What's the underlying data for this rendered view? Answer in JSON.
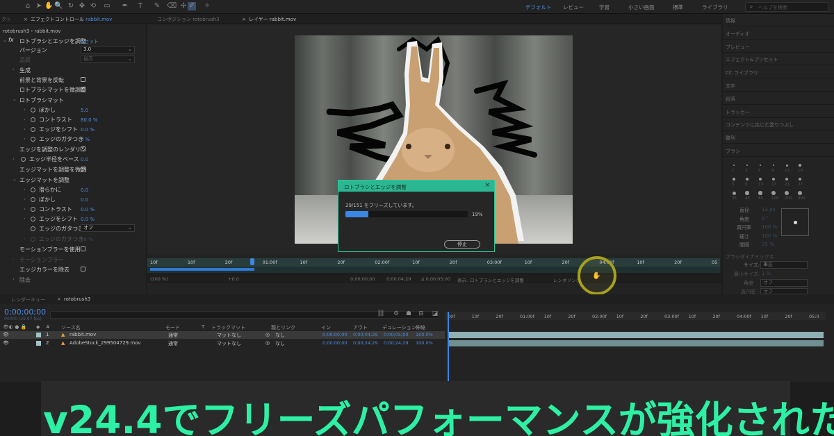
{
  "topbar": {
    "workspaces": [
      "デフォルト",
      "レビュー",
      "学習",
      "小さい画面",
      "標準",
      "ライブラリ"
    ],
    "active_workspace": "デフォルト",
    "search_placeholder": "ヘルプを検索"
  },
  "effects_panel": {
    "tab_partial": "クト",
    "tab_label": "エフェクトコントロール",
    "tab_file": "rabbit.mov",
    "subtitle": "rotobrush3・rabbit.mov",
    "fx_label": "fx",
    "effect_name": "ロトブラシとエッジを調整",
    "reset": "リセット",
    "properties": [
      {
        "label": "バージョン",
        "value": "3.0"
      },
      {
        "label": "品質",
        "value": "最高"
      },
      {
        "label": "生成"
      },
      {
        "label": "前景と背景を反転"
      },
      {
        "label": "ロトブラシマットを微調整"
      },
      {
        "label": "ロトブラシマット"
      },
      {
        "label": "ぼかし",
        "value": "5.0"
      },
      {
        "label": "コントラスト",
        "value": "80.0 %"
      },
      {
        "label": "エッジをシフト",
        "value": "0.0 %"
      },
      {
        "label": "エッジのガタつき",
        "value": "0 %"
      },
      {
        "label": "エッジを調整のレンダリン"
      },
      {
        "label": "エッジ半径をベース",
        "value": "0.0"
      },
      {
        "label": "エッジマットを調整を微調"
      },
      {
        "label": "エッジマットを調整"
      },
      {
        "label": "滑らかに",
        "value": "0.0"
      },
      {
        "label": "ぼかし",
        "value": "0.0"
      },
      {
        "label": "コントラスト",
        "value": "0.0 %"
      },
      {
        "label": "エッジをシフト",
        "value": "0.0 %"
      },
      {
        "label": "エッジのガタつき",
        "value": "オフ"
      },
      {
        "label": "エッジのガタつき",
        "value": "50 %"
      },
      {
        "label": "モーションブラーを使用"
      },
      {
        "label": "モーションブラー"
      },
      {
        "label": "エッジカラーを除去"
      },
      {
        "label": "除去"
      }
    ]
  },
  "comp_tabs": {
    "composition": "コンポジション rotobrush3",
    "layer": "レイヤー rabbit.mov"
  },
  "dialog": {
    "title": "ロトブラシとエッジを調整",
    "close": "×",
    "message": "29/151 をフリーズしています。",
    "progress_percent": 19,
    "progress_label": "19%",
    "stop_button": "停止"
  },
  "viewer_ruler": [
    "10f",
    "10f",
    "20f",
    "01:00f",
    "10f",
    "20f",
    "02:00f",
    "10f",
    "20f",
    "03:00f",
    "10f",
    "20f",
    "04:00f",
    "10f",
    "20f",
    "05"
  ],
  "viewer_bar": {
    "zoom": "(100 %)",
    "exposure": "+0.0",
    "in": "0;00;00;00",
    "out": "0;00;04;29",
    "duration": "Δ 0;00;05;00",
    "view_label": "表示:",
    "view_value": "ロトブラシとエッジを調整",
    "render": "レンダリング"
  },
  "right_panel": {
    "items": [
      "情報",
      "オーディオ",
      "プレビュー",
      "エフェクト&プリセット",
      "CC ライブラリ",
      "文字",
      "段落",
      "トラッカー",
      "コンテンツに応じた塗りつぶし",
      "整列",
      "ブラシ"
    ],
    "brush_sizes": [
      "1",
      "3",
      "5",
      "9",
      "13",
      "19",
      "5",
      "9",
      "13",
      "17",
      "21",
      "27",
      "35",
      "45",
      "65",
      "100",
      "200",
      "300"
    ],
    "brush_props": [
      {
        "label": "直径",
        "value": "13 px"
      },
      {
        "label": "角度",
        "value": "0 °"
      },
      {
        "label": "真円率",
        "value": "100 %"
      },
      {
        "label": "硬さ",
        "value": "100 %"
      },
      {
        "label": "間隔",
        "value": "25 %"
      }
    ],
    "dynamics": "ブラシダイナミックス",
    "dyn_size_label": "サイズ:",
    "dyn_size_value": "筆圧",
    "dyn_min_size_label": "最小サイズ:",
    "dyn_min_size_value": "1 %",
    "dyn_angle": "角度",
    "dyn_roundness": "真円率",
    "off": "オフ"
  },
  "timeline": {
    "tab_render": "レンダーキュー",
    "tab_comp": "rotobrush3",
    "timecode": "0;00;00;00",
    "fps": "00000 (29.97 fps)",
    "columns": {
      "source": "ソース名",
      "mode": "モード",
      "t": "T",
      "track_matte": "トラックマット",
      "parent": "親とリンク",
      "in": "イン",
      "out": "アウト",
      "duration": "デュレーション",
      "stretch": "伸縮"
    },
    "layers": [
      {
        "num": "1",
        "name": "rabbit.mov",
        "mode": "通常",
        "matte": "マットなし",
        "parent": "なし",
        "in": "0;00;00;00",
        "out": "0;00;04;29",
        "duration": "0;00;05;00",
        "stretch": "100.0%"
      },
      {
        "num": "2",
        "name": "AdobeStock_299504729.mov",
        "mode": "通常",
        "matte": "マットなし",
        "parent": "なし",
        "in": "0;00;00;00",
        "out": "0;00;24;29",
        "duration": "0;00;24;29",
        "stretch": "100.0%"
      }
    ],
    "ruler": [
      "00f",
      "10f",
      "20f",
      "01:00f",
      "10f",
      "20f",
      "02:00f",
      "10f",
      "20f",
      "03:00f",
      "10f",
      "20f",
      "04:00f",
      "10f",
      "20f",
      "05:0"
    ]
  },
  "caption": "v24.4でフリーズパフォーマンスが強化された",
  "colors": {
    "accent": "#4c8de6",
    "dialog_header": "#2ab791",
    "caption_text": "#2df0a4",
    "cursor_ring": "#a7a01f"
  }
}
